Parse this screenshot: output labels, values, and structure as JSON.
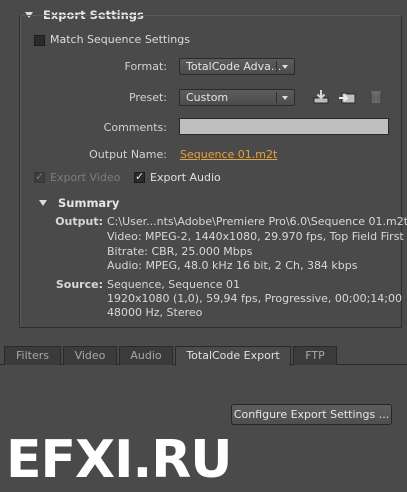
{
  "export_settings": {
    "title": "Export Settings",
    "match_sequence_label": "Match Sequence Settings",
    "match_sequence_checked": false,
    "format_label": "Format:",
    "format_value": "TotalCode Adva...",
    "preset_label": "Preset:",
    "preset_value": "Custom",
    "comments_label": "Comments:",
    "comments_value": "",
    "output_name_label": "Output Name:",
    "output_name_value": "Sequence 01.m2t",
    "export_video_label": "Export Video",
    "export_video_checked": true,
    "export_video_disabled": true,
    "export_audio_label": "Export Audio",
    "export_audio_checked": true
  },
  "summary": {
    "title": "Summary",
    "output_key": "Output:",
    "output_lines": [
      "C:\\User...nts\\Adobe\\Premiere Pro\\6.0\\Sequence 01.m2t",
      "Video: MPEG-2, 1440x1080, 29.970 fps, Top Field First",
      "Bitrate: CBR, 25.000 Mbps",
      "Audio: MPEG, 48.0 kHz 16 bit, 2 Ch, 384 kbps"
    ],
    "source_key": "Source:",
    "source_lines": [
      "Sequence, Sequence 01",
      "1920x1080 (1,0), 59,94 fps, Progressive, 00;00;14;00",
      "48000 Hz, Stereo"
    ]
  },
  "tabs": [
    {
      "label": "Filters",
      "active": false
    },
    {
      "label": "Video",
      "active": false
    },
    {
      "label": "Audio",
      "active": false
    },
    {
      "label": "TotalCode Export",
      "active": true
    },
    {
      "label": "FTP",
      "active": false
    }
  ],
  "configure_button_label": "Configure Export Settings ...",
  "watermark_text": "EFXI.RU",
  "icons": [
    "save-preset-icon",
    "import-preset-icon",
    "delete-preset-icon"
  ]
}
